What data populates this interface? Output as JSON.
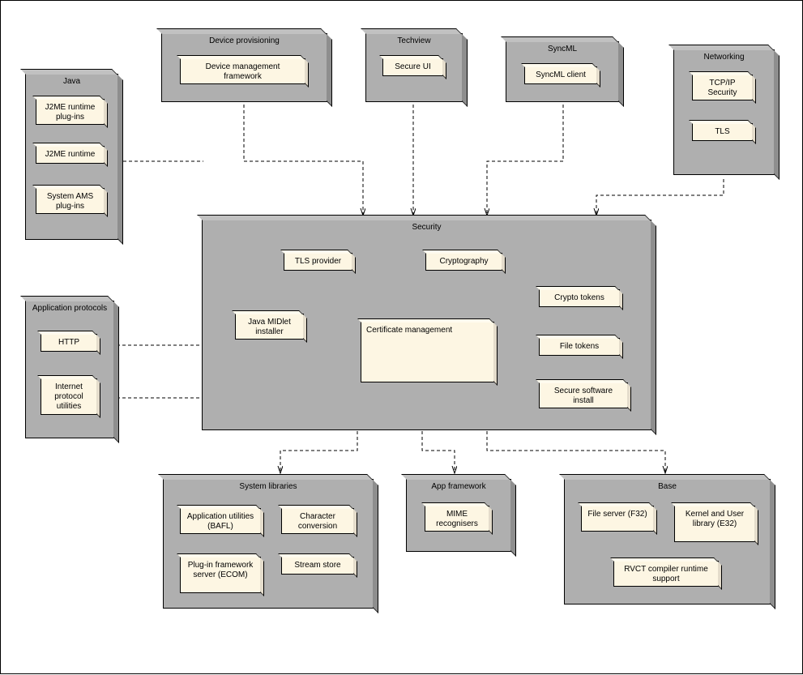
{
  "packages": {
    "java": {
      "title": "Java"
    },
    "devprov": {
      "title": "Device provisioning"
    },
    "techview": {
      "title": "Techview"
    },
    "syncml": {
      "title": "SyncML"
    },
    "networking": {
      "title": "Networking"
    },
    "appproto": {
      "title": "Application protocols"
    },
    "security": {
      "title": "Security"
    },
    "syslibs": {
      "title": "System libraries"
    },
    "appfw": {
      "title": "App framework"
    },
    "base": {
      "title": "Base"
    }
  },
  "components": {
    "j2me_plugins": "J2ME runtime plug-ins",
    "j2me_runtime": "J2ME runtime",
    "sys_ams": "System AMS plug-ins",
    "dmf": "Device management framework",
    "secure_ui": "Secure UI",
    "syncml_client": "SyncML client",
    "tcpip_sec": "TCP/IP Security",
    "tls": "TLS",
    "http": "HTTP",
    "ipu": "Internet protocol utilities",
    "tls_provider": "TLS provider",
    "java_midlet": "Java MIDlet installer",
    "crypto": "Cryptography",
    "certmgmt": "Certificate management",
    "crypto_tokens": "Crypto tokens",
    "file_tokens": "File tokens",
    "ssi": "Secure software install",
    "app_utils": "Application utilities (BAFL)",
    "char_conv": "Character conversion",
    "ecom": "Plug-in framework server (ECOM)",
    "stream": "Stream store",
    "mime": "MIME recognisers",
    "f32": "File server (F32)",
    "e32": "Kernel and User library (E32)",
    "rvct": "RVCT compiler runtime support"
  },
  "chart_data": {
    "type": "diagram",
    "description": "UML-style package / component dependency diagram",
    "packages": [
      {
        "name": "Java",
        "components": [
          "J2ME runtime plug-ins",
          "J2ME runtime",
          "System AMS plug-ins"
        ]
      },
      {
        "name": "Device provisioning",
        "components": [
          "Device management framework"
        ]
      },
      {
        "name": "Techview",
        "components": [
          "Secure UI"
        ]
      },
      {
        "name": "SyncML",
        "components": [
          "SyncML client"
        ]
      },
      {
        "name": "Networking",
        "components": [
          "TCP/IP Security",
          "TLS"
        ]
      },
      {
        "name": "Application protocols",
        "components": [
          "HTTP",
          "Internet protocol utilities"
        ]
      },
      {
        "name": "Security",
        "components": [
          "TLS provider",
          "Java MIDlet installer",
          "Cryptography",
          "Certificate management",
          "Crypto tokens",
          "File tokens",
          "Secure software install"
        ]
      },
      {
        "name": "System libraries",
        "components": [
          "Application utilities (BAFL)",
          "Character conversion",
          "Plug-in framework server (ECOM)",
          "Stream store"
        ]
      },
      {
        "name": "App framework",
        "components": [
          "MIME recognisers"
        ]
      },
      {
        "name": "Base",
        "components": [
          "File server (F32)",
          "Kernel and User library (E32)",
          "RVCT compiler runtime support"
        ]
      }
    ],
    "connectors": [
      {
        "from": "Device provisioning",
        "to": "Security",
        "style": "dashed-arrow"
      },
      {
        "from": "Techview",
        "to": "Security",
        "style": "dashed-arrow"
      },
      {
        "from": "SyncML",
        "to": "Security",
        "style": "dashed-arrow"
      },
      {
        "from": "Networking",
        "to": "Security",
        "style": "dashed-arrow"
      },
      {
        "from": "Java",
        "to": "Security",
        "style": "dashed-arrow-bidir"
      },
      {
        "from": "TLS provider",
        "to": "Certificate management",
        "style": "dashed-arrow"
      },
      {
        "from": "Java MIDlet installer",
        "to": "Certificate management",
        "style": "dashed-arrow"
      },
      {
        "from": "Cryptography",
        "to": "Certificate management",
        "style": "dashed-arrow-bidir"
      },
      {
        "from": "Certificate management",
        "to": "Crypto tokens",
        "style": "dashed-arrow-bidir"
      },
      {
        "from": "Certificate management",
        "to": "File tokens",
        "style": "dashed-arrow-bidir"
      },
      {
        "from": "Certificate management",
        "to": "Secure software install",
        "style": "dashed-arrow-bidir"
      },
      {
        "from": "Security",
        "to": "HTTP",
        "style": "dashed-arrow"
      },
      {
        "from": "Security",
        "to": "Internet protocol utilities",
        "style": "dashed-arrow"
      },
      {
        "from": "Security",
        "to": "System libraries",
        "style": "dashed-arrow"
      },
      {
        "from": "Security",
        "to": "App framework",
        "style": "dashed-arrow"
      },
      {
        "from": "Security",
        "to": "Base",
        "style": "dashed-arrow"
      }
    ]
  }
}
